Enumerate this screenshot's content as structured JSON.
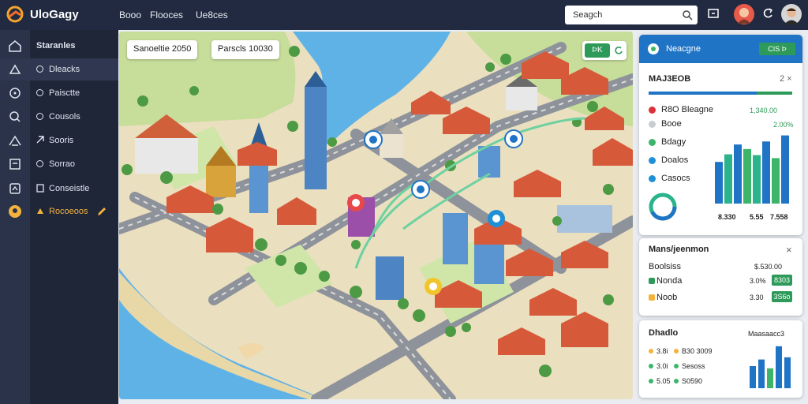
{
  "app": {
    "brand": "UloGagy"
  },
  "nav": [
    "Booo",
    "Flooces",
    "Ue8ces"
  ],
  "search": {
    "text": "Seagch"
  },
  "sidebar": {
    "section": "Staranles",
    "items": [
      {
        "label": "Dleacks",
        "icon": "compass-icon"
      },
      {
        "label": "Paisctte",
        "icon": "location-icon"
      },
      {
        "label": "Cousols",
        "icon": "chat-icon"
      },
      {
        "label": "Sooris",
        "icon": "link-icon"
      },
      {
        "label": "Sorrao",
        "icon": "calendar-icon"
      },
      {
        "label": "Conseistle",
        "icon": "document-icon"
      },
      {
        "label": "Rocoeoos",
        "icon": "badge-icon",
        "active": true
      }
    ]
  },
  "map_chips": {
    "left": "Sanoeltie 2050",
    "right": "Parscls 10030"
  },
  "map_button": {
    "label": "ÞK"
  },
  "panel1": {
    "title": "Neacgne",
    "badge": "CIS Þ",
    "subtitle": "MAJ3EOB",
    "close": "2 ×",
    "rows": [
      {
        "name": "R8O Bleagne",
        "value": "1,340.00",
        "color": "#d9323a"
      },
      {
        "name": "Booe",
        "value": "2.00%",
        "color": "#c8ccd2"
      },
      {
        "name": "Bdagy",
        "value": "",
        "color": "#3cb56a"
      },
      {
        "name": "Doalos",
        "value": "",
        "color": "#1f8fd6"
      },
      {
        "name": "Casocs",
        "value": "",
        "color": "#1f8fd6"
      }
    ],
    "axis": [
      "8.330",
      "5.55",
      "7.558"
    ],
    "bars": [
      {
        "value": 55,
        "color": "#1f74c6"
      },
      {
        "value": 65,
        "color": "#2bb38b"
      },
      {
        "value": 78,
        "color": "#1f74c6"
      },
      {
        "value": 72,
        "color": "#3cb56a"
      },
      {
        "value": 64,
        "color": "#2bb38b"
      },
      {
        "value": 82,
        "color": "#1f74c6"
      },
      {
        "value": 60,
        "color": "#3cb56a"
      },
      {
        "value": 90,
        "color": "#1f74c6"
      }
    ]
  },
  "panel2": {
    "title": "Mans/jeenmon",
    "close": "×",
    "rows": [
      {
        "name": "Boolsiss",
        "value": "$.530.00",
        "color": ""
      },
      {
        "name": "Nonda",
        "value": "3.0%",
        "badge": "8303",
        "color": "#2e9a5a"
      },
      {
        "name": "Noob",
        "value": "3.30",
        "badge": "3S6o",
        "color": "#f3b33d"
      }
    ]
  },
  "panel3": {
    "title": "Dhadlo",
    "value": "Maasaacc3",
    "rows": [
      {
        "a": "3.8i",
        "b": "B30 3009",
        "color": "#f3b33d"
      },
      {
        "a": "3.0i",
        "b": "Sesoss",
        "color": "#3cb56a"
      },
      {
        "a": "5.05",
        "b": "S0590",
        "color": "#3cb56a"
      }
    ],
    "bars": [
      {
        "value": 50,
        "color": "#1f74c6"
      },
      {
        "value": 65,
        "color": "#1f74c6"
      },
      {
        "value": 45,
        "color": "#3cb56a"
      },
      {
        "value": 95,
        "color": "#1f74c6"
      },
      {
        "value": 70,
        "color": "#1f74c6"
      }
    ]
  }
}
